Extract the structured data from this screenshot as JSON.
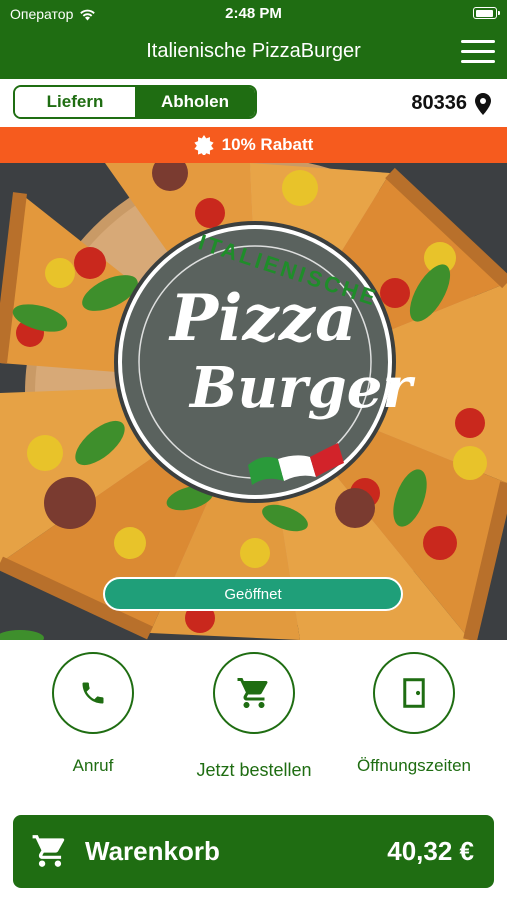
{
  "status_bar": {
    "carrier": "Оператор",
    "time": "2:48 PM"
  },
  "header": {
    "title": "Italienische PizzaBurger"
  },
  "mode": {
    "delivery_label": "Liefern",
    "pickup_label": "Abholen",
    "selected": "Abholen"
  },
  "location": {
    "zip": "80336"
  },
  "promo": {
    "text": "10% Rabatt"
  },
  "logo": {
    "line1": "ITALIENISCHE",
    "word1": "Pizza",
    "word2": "Burger"
  },
  "hero": {
    "status_label": "Geöffnet"
  },
  "actions": [
    {
      "label": "Anruf",
      "icon": "phone-icon"
    },
    {
      "label": "Jetzt bestellen",
      "icon": "cart-icon"
    },
    {
      "label": "Öffnungszeiten",
      "icon": "door-icon"
    }
  ],
  "cart": {
    "label": "Warenkorb",
    "total": "40,32 €"
  },
  "colors": {
    "brand_green": "#1f6d12",
    "promo_orange": "#f65b1e",
    "open_green": "#1f9f79"
  }
}
